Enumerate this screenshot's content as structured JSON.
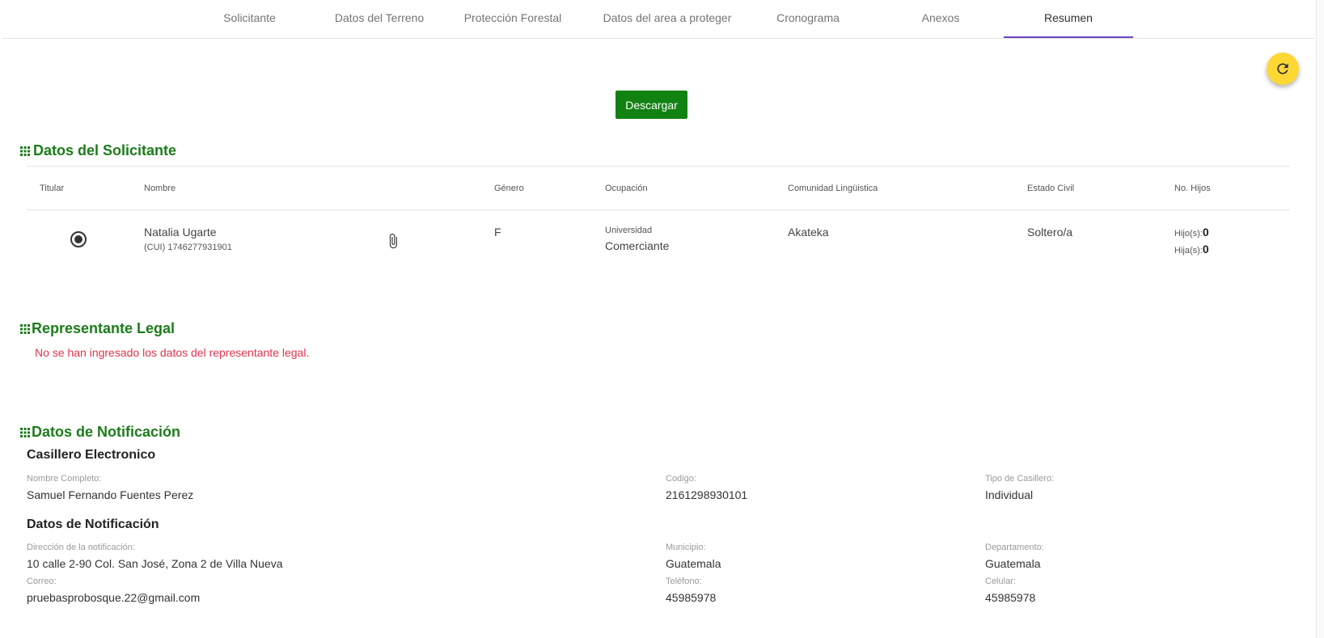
{
  "tabs": [
    {
      "label": "Solicitante"
    },
    {
      "label": "Datos del Terreno"
    },
    {
      "label": "Protección Forestal"
    },
    {
      "label": "Datos del area a proteger"
    },
    {
      "label": "Cronograma"
    },
    {
      "label": "Anexos"
    },
    {
      "label": "Resumen"
    }
  ],
  "active_tab": "Resumen",
  "download_label": "Descargar",
  "solicitante": {
    "title": "Datos del Solicitante",
    "headers": {
      "titular": "Titular",
      "nombre": "Nombre",
      "genero": "Género",
      "ocupacion": "Ocupación",
      "comunidad": "Comunidad Lingüistica",
      "estado_civil": "Estado Civil",
      "hijos": "No. Hijos"
    },
    "row": {
      "nombre": "Natalia Ugarte",
      "cui": "(CUI) 1746277931901",
      "genero": "F",
      "ocupacion_nivel": "Universidad",
      "ocupacion": "Comerciante",
      "comunidad": "Akateka",
      "estado_civil": "Soltero/a",
      "hijos_label": "Hijo(s):",
      "hijos": "0",
      "hijas_label": "Hija(s):",
      "hijas": "0"
    }
  },
  "representante": {
    "title": "Representante Legal",
    "error": "No se han ingresado los datos del representante legal."
  },
  "notificacion": {
    "title": "Datos de Notificación",
    "casillero_title": "Casillero Electronico",
    "nombre_label": "Nombre Completo:",
    "nombre": "Samuel Fernando Fuentes Perez",
    "codigo_label": "Codigo:",
    "codigo": "2161298930101",
    "tipo_label": "Tipo de Casillero:",
    "tipo": "Individual",
    "datos_title": "Datos de Notificación",
    "direccion_label": "Dirección de la notificación:",
    "direccion": "10 calle 2-90 Col. San José, Zona 2 de Villa Nueva",
    "municipio_label": "Municipio:",
    "municipio": "Guatemala",
    "departamento_label": "Departamento:",
    "departamento": "Guatemala",
    "correo_label": "Correo:",
    "correo": "pruebasprobosque.22@gmail.com",
    "telefono_label": "Teléfono:",
    "telefono": "45985978",
    "celular_label": "Celular:",
    "celular": "45985978"
  },
  "colors": {
    "accent_green": "#1b7d1b",
    "button_green": "#118211",
    "tab_indicator": "#6b46c1",
    "error_red": "#e0344c",
    "fab_yellow": "#fdd835"
  },
  "icons": {
    "fab": "refresh-icon",
    "section": "grid-dots-icon",
    "attachment": "paperclip-icon",
    "titular": "radio-selected-icon"
  }
}
